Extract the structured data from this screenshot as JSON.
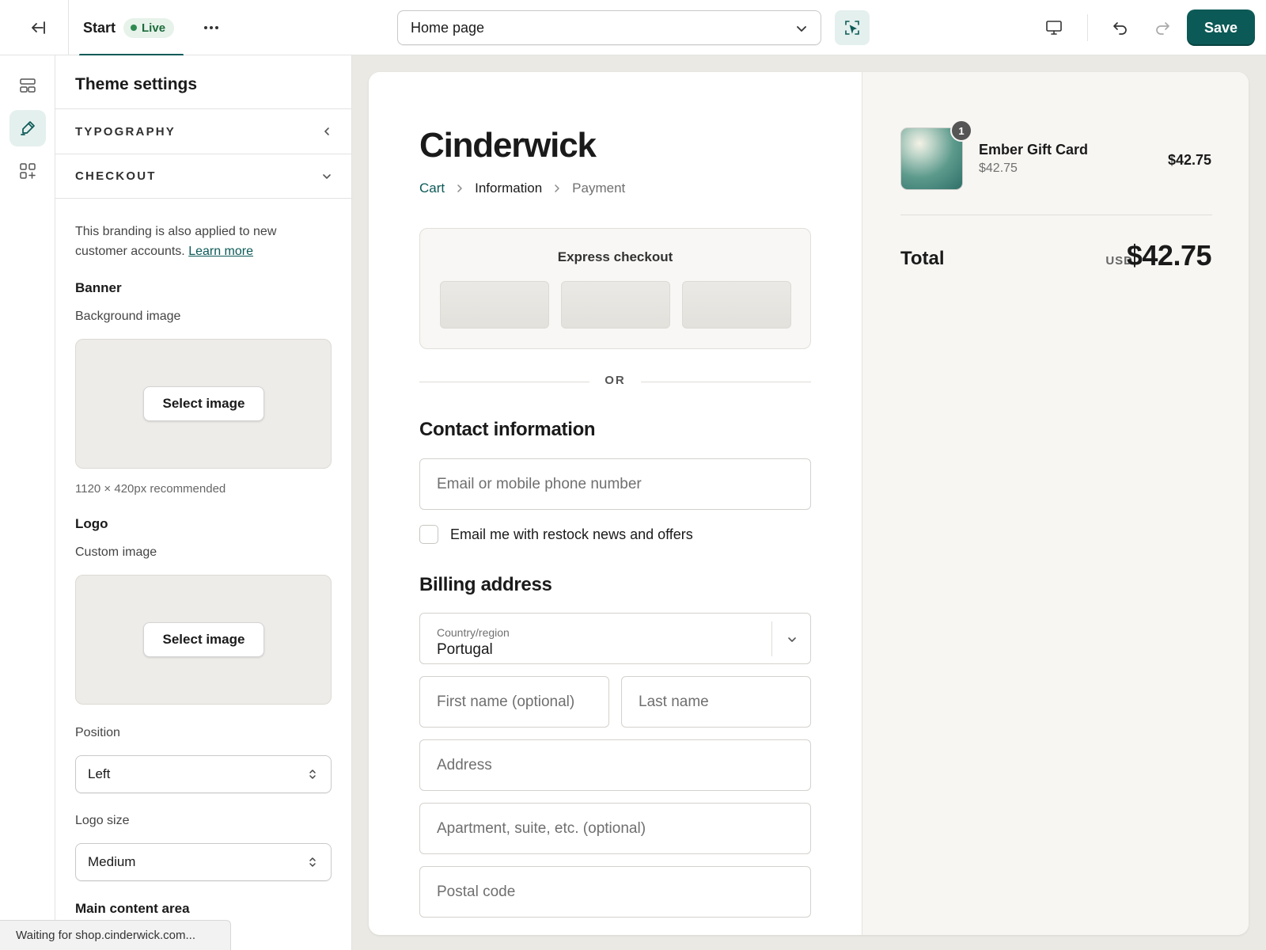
{
  "topbar": {
    "theme_name": "Start",
    "live_badge": "Live",
    "more_label": "···",
    "page_select": "Home page",
    "save_label": "Save"
  },
  "panel": {
    "title": "Theme settings",
    "sections": {
      "typography": "TYPOGRAPHY",
      "checkout": "CHECKOUT"
    },
    "help_text": "This branding is also applied to new customer accounts.",
    "learn_more": "Learn more",
    "banner": {
      "heading": "Banner",
      "bg_label": "Background image",
      "select_label": "Select image",
      "hint": "1120 × 420px recommended"
    },
    "logo": {
      "heading": "Logo",
      "custom_label": "Custom image",
      "select_label": "Select image",
      "position_label": "Position",
      "position_value": "Left",
      "size_label": "Logo size",
      "size_value": "Medium"
    },
    "main_content_heading": "Main content area"
  },
  "status_bar": "Waiting for shop.cinderwick.com...",
  "checkout": {
    "shop_name": "Cinderwick",
    "breadcrumb": [
      "Cart",
      "Information",
      "Payment"
    ],
    "express_title": "Express checkout",
    "or_label": "OR",
    "contact_heading": "Contact information",
    "email_placeholder": "Email or mobile phone number",
    "marketing_optin": "Email me with restock news and offers",
    "billing_heading": "Billing address",
    "country_label": "Country/region",
    "country_value": "Portugal",
    "first_name_placeholder": "First name (optional)",
    "last_name_placeholder": "Last name",
    "address_placeholder": "Address",
    "apartment_placeholder": "Apartment, suite, etc. (optional)",
    "postal_placeholder": "Postal code"
  },
  "summary": {
    "item_name": "Ember Gift Card",
    "item_sub_price": "$42.75",
    "item_price": "$42.75",
    "quantity": "1",
    "total_label": "Total",
    "currency": "USD",
    "total_amount": "$42.75"
  },
  "colors": {
    "brand": "#0c5a57",
    "live_bg": "#e6f2ea",
    "preview_bg": "#ebe9e4"
  }
}
